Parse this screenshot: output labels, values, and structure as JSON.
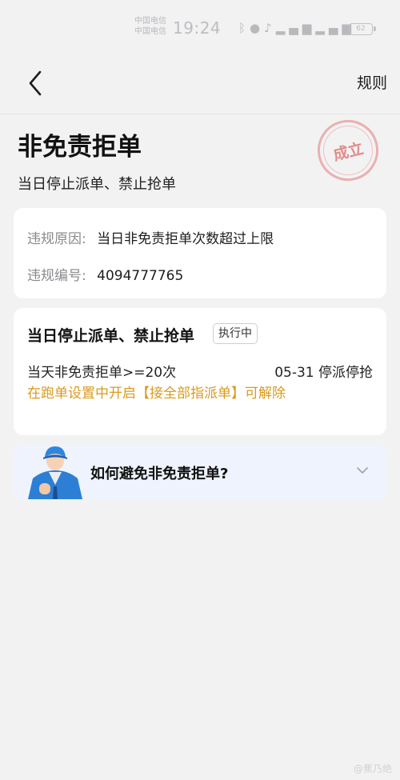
{
  "status_bar": {
    "carrier_1": "中国电信",
    "carrier_2": "中国电信",
    "time": "19:24",
    "battery": "62",
    "icons": [
      "nfc-icon",
      "location-icon",
      "mic-icon",
      "signal-icon",
      "signal-icon",
      "battery-icon"
    ]
  },
  "nav": {
    "back_icon": "chevron-left-icon",
    "rules_label": "规则"
  },
  "header": {
    "title": "非免责拒单",
    "subtitle": "当日停止派单、禁止抢单",
    "stamp": "成立"
  },
  "violation": {
    "reason_label": "违规原因:",
    "reason_value": "当日非免责拒单次数超过上限",
    "id_label": "违规编号:",
    "id_value": "4094777765"
  },
  "penalty": {
    "title": "当日停止派单、禁止抢单",
    "status": "执行中",
    "rule": "当天非免责拒单>=20次",
    "date": "05-31 停派停抢",
    "tip": "在跑单设置中开启【接全部指派单】可解除"
  },
  "faq": {
    "question": "如何避免非免责拒单?"
  },
  "footer": {
    "watermark": "@蕉乃绝"
  },
  "colors": {
    "background": "#f2f2f3",
    "card": "#ffffff",
    "tip": "#d99a1e",
    "stamp": "#e08c8c",
    "faq_background": "#eef3fd"
  }
}
